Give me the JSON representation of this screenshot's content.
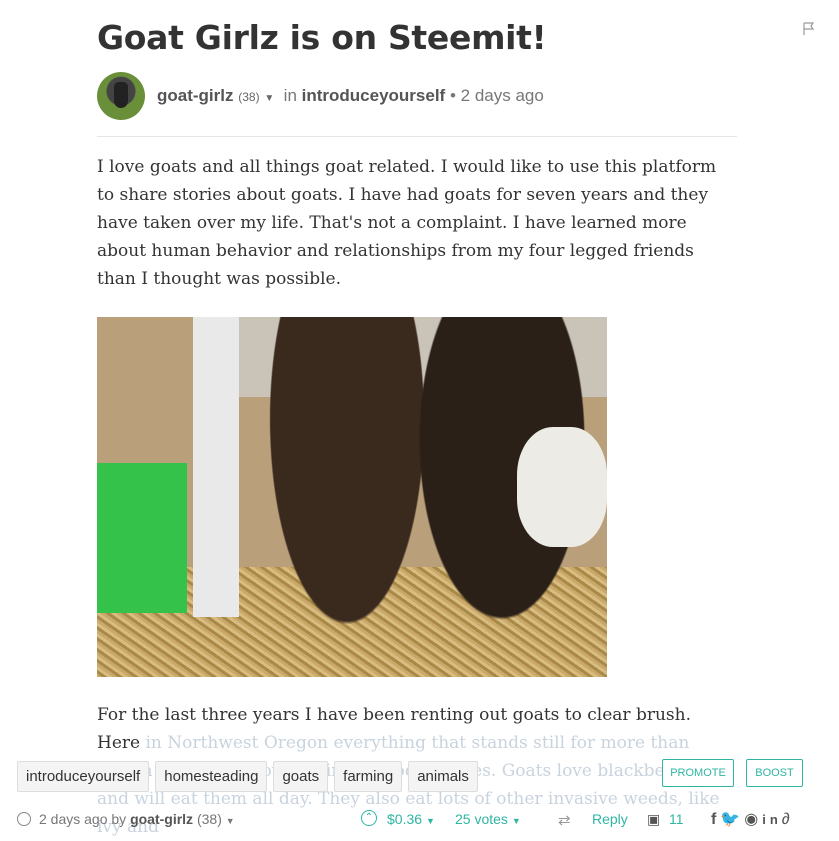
{
  "post": {
    "title": "Goat Girlz is on Steemit!",
    "author": "goat-girlz",
    "reputation": "(38)",
    "in_label": "in",
    "category": "introduceyourself",
    "separator": "•",
    "time_ago": "2 days ago",
    "paragraph1": "I love goats and all things goat related. I would like to use this platform to share stories about goats. I have had goats for seven years and they have taken over my life. That's not a complaint. I have learned more about human behavior and relationships from my four legged friends than I thought was possible.",
    "paragraph2_visible": "For the last three years I have been renting out goats to clear brush. Here",
    "paragraph2_faded": "in Northwest Oregon everything that stands still for more than fifteen minutes is covered in blackberry vines. Goats love blackberries and will eat them all day. They also eat lots of other invasive weeds, like ivy and"
  },
  "tags": [
    "introduceyourself",
    "homesteading",
    "goats",
    "farming",
    "animals"
  ],
  "actions": {
    "promote": "PROMOTE",
    "boost": "BOOST"
  },
  "footer": {
    "time_prefix": "2 days ago by",
    "author": "goat-girlz",
    "reputation": "(38)",
    "payout": "$0.36",
    "votes": "25 votes",
    "reply": "Reply",
    "comments": "11"
  },
  "colors": {
    "accent": "#2fb6a3",
    "text": "#333333",
    "muted": "#777777"
  },
  "icons": [
    "flag-icon",
    "clock-icon",
    "upvote-icon",
    "resteem-icon",
    "comments-icon",
    "facebook-icon",
    "twitter-icon",
    "reddit-icon",
    "linkedin-icon",
    "link-icon"
  ]
}
